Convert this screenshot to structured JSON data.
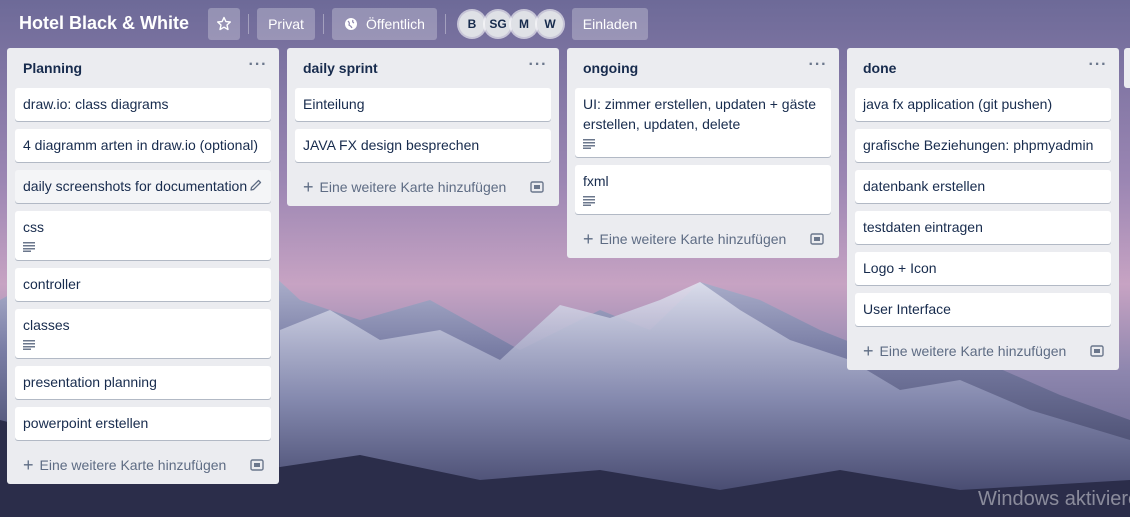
{
  "board": {
    "title": "Hotel Black & White",
    "star_icon": "star-icon",
    "visibility_private": "Privat",
    "visibility_public": "Öffentlich",
    "globe_icon": "globe-icon",
    "members": [
      "B",
      "SG",
      "M",
      "W"
    ],
    "invite_label": "Einladen"
  },
  "lists": [
    {
      "title": "Planning",
      "cards": [
        {
          "text": "draw.io: class diagrams"
        },
        {
          "text": "4 diagramm arten in draw.io (optional)"
        },
        {
          "text": "daily screenshots for documentation"
        },
        {
          "text": "css",
          "has_description": true
        },
        {
          "text": "controller"
        },
        {
          "text": "classes",
          "has_description": true
        },
        {
          "text": "presentation planning"
        },
        {
          "text": "powerpoint erstellen"
        }
      ],
      "add_card_label": "Eine weitere Karte hinzufügen"
    },
    {
      "title": "daily sprint",
      "cards": [
        {
          "text": "Einteilung"
        },
        {
          "text": "JAVA FX design besprechen"
        }
      ],
      "add_card_label": "Eine weitere Karte hinzufügen"
    },
    {
      "title": "ongoing",
      "cards": [
        {
          "text": "UI: zimmer erstellen, updaten + gäste erstellen, updaten, delete",
          "has_description": true
        },
        {
          "text": "fxml",
          "has_description": true
        }
      ],
      "add_card_label": "Eine weitere Karte hinzufügen"
    },
    {
      "title": "done",
      "cards": [
        {
          "text": "java fx application (git pushen)"
        },
        {
          "text": "grafische Beziehungen: phpmyadmin"
        },
        {
          "text": "datenbank erstellen"
        },
        {
          "text": "testdaten eintragen"
        },
        {
          "text": "Logo + Icon"
        },
        {
          "text": "User Interface"
        }
      ],
      "add_card_label": "Eine weitere Karte hinzufügen"
    }
  ],
  "watermark": "Windows aktiviere",
  "colors": {
    "list_bg": "#ebecf0",
    "card_bg": "#ffffff",
    "text": "#172b4d",
    "muted": "#5e6c84"
  }
}
